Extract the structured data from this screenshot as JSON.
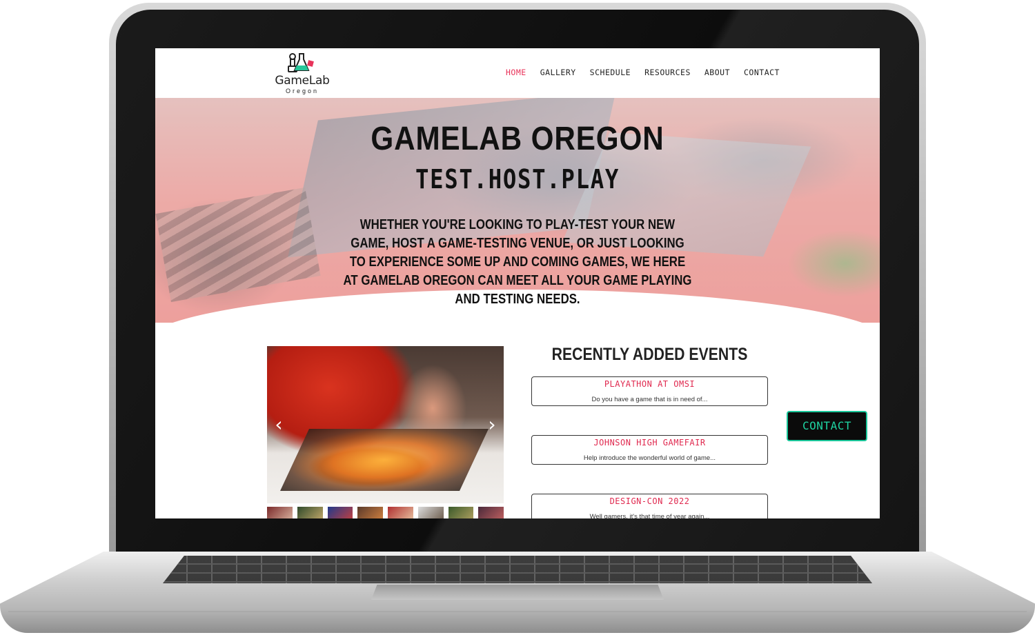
{
  "site": {
    "logo_name": "GameLab",
    "logo_sub": "Oregon"
  },
  "nav": {
    "items": [
      {
        "label": "HOME",
        "active": true
      },
      {
        "label": "GALLERY",
        "active": false
      },
      {
        "label": "SCHEDULE",
        "active": false
      },
      {
        "label": "RESOURCES",
        "active": false
      },
      {
        "label": "ABOUT",
        "active": false
      },
      {
        "label": "CONTACT",
        "active": false
      }
    ]
  },
  "hero": {
    "title": "GAMELAB OREGON",
    "tagline": "TEST.HOST.PLAY",
    "description": "Whether you're looking to play-test your new game, host a game-testing venue, or just looking to experience some up and coming games, we here at GameLab Oregon can meet all your game playing and testing needs."
  },
  "slider": {
    "prev": "‹",
    "next": "›",
    "thumb_count": 8
  },
  "events": {
    "heading": "RECENTLY ADDED EVENTS",
    "items": [
      {
        "name": "PLAYATHON AT OMSI",
        "excerpt": "Do you have a game that is in need of..."
      },
      {
        "name": "JOHNSON HIGH GAMEFAIR",
        "excerpt": "Help introduce the wonderful world of game..."
      },
      {
        "name": "DESIGN-CON 2022",
        "excerpt": "Well gamers, it's that time of year again..."
      }
    ]
  },
  "contact_button": "CONTACT",
  "colors": {
    "accent": "#e8335a",
    "contact_button_text": "#1fd3a2",
    "contact_button_bg": "#0b0b0b"
  }
}
